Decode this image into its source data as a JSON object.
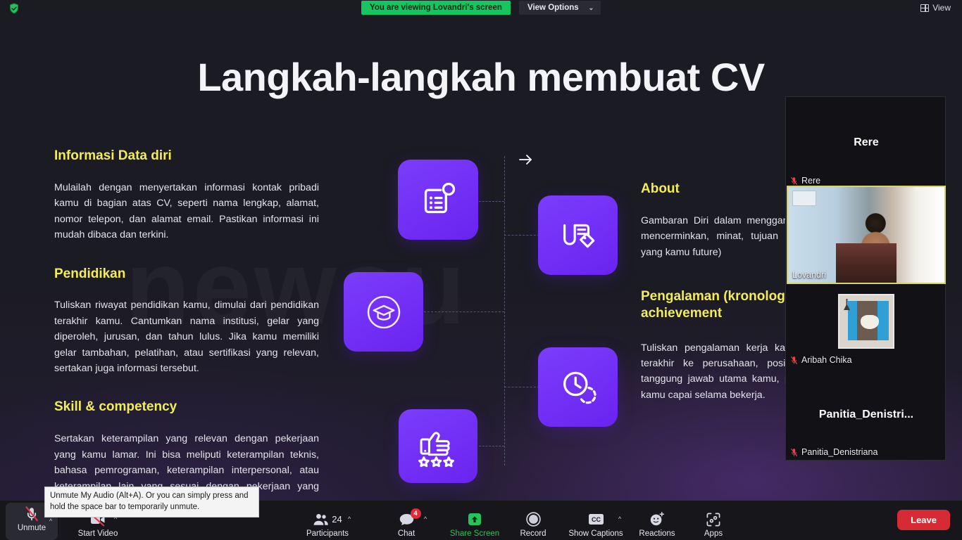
{
  "topbar": {
    "encryption_icon": "shield-check-icon",
    "share_banner": "You are viewing Lovandri's screen",
    "view_options_label": "View Options",
    "view_options_caret": "⌄",
    "view_button_label": "View",
    "view_button_icon": "grid-view-icon"
  },
  "slide": {
    "title": "Langkah-langkah membuat CV",
    "watermark": "newsu",
    "cursor_icon": "arrow-right-cursor",
    "left_sections": [
      {
        "heading": "Informasi Data diri",
        "body": "Mulailah dengan menyertakan informasi kontak pribadi kamu di bagian atas CV, seperti nama lengkap, alamat, nomor telepon, dan alamat email. Pastikan informasi ini mudah dibaca dan terkini."
      },
      {
        "heading": "Pendidikan",
        "body": "Tuliskan riwayat pendidikan kamu, dimulai dari pendidikan terakhir kamu. Cantumkan nama institusi, gelar yang diperoleh, jurusan, dan tahun lulus. Jika kamu memiliki gelar tambahan, pelatihan, atau sertifikasi yang relevan, sertakan juga informasi tersebut."
      },
      {
        "heading": "Skill & competency",
        "body": "Sertakan keterampilan yang relevan dengan pekerjaan yang kamu lamar. Ini bisa meliputi keterampilan teknis, bahasa pemrograman, keterampilan interpersonal, atau keterampilan lain yang sesuai dengan pekerjaan yang kamu lamar."
      }
    ],
    "right_sections": [
      {
        "heading": "About",
        "body": "Gambaran Diri dalam menggambarkan diri kamu, mencerminkan, minat, tujuan keterampilan kunci yang kamu future)"
      },
      {
        "heading": "Pengalaman (kronologi) & achievement",
        "body": "Tuliskan pengalaman kerja kamu dari pekerjaan terakhir ke perusahaan, posisi yang diperoleh tanggung jawab utama kamu, prestasi yang telah kamu capai selama bekerja."
      }
    ],
    "icon_tiles": [
      {
        "name": "clipboard-list-icon"
      },
      {
        "name": "graduation-cap-icon"
      },
      {
        "name": "document-tag-icon"
      },
      {
        "name": "clock-history-icon"
      },
      {
        "name": "thumbs-up-stars-icon"
      }
    ]
  },
  "participants_panel": [
    {
      "display_name": "Rere",
      "label": "Rere",
      "muted": true,
      "has_video": false,
      "avatar": "none"
    },
    {
      "display_name": "Lovandri",
      "label": "Lovandri",
      "muted": false,
      "has_video": true,
      "avatar": "video"
    },
    {
      "display_name": "Aribah Chika",
      "label": "Aribah Chika",
      "muted": true,
      "has_video": false,
      "avatar": "photo"
    },
    {
      "display_name": "Panitia_Denistri...",
      "label": "Panitia_Denistriana",
      "muted": true,
      "has_video": false,
      "avatar": "none"
    }
  ],
  "tooltip": {
    "text": "Unmute My Audio (Alt+A). Or you can simply press and hold the space bar to temporarily unmute."
  },
  "toolbar": {
    "items": [
      {
        "label": "Unmute",
        "icon": "microphone-muted-icon",
        "caret": true,
        "badge": null,
        "count": null,
        "highlight": false,
        "active": true
      },
      {
        "label": "Start Video",
        "icon": "camera-off-icon",
        "caret": true,
        "badge": null,
        "count": null,
        "highlight": false,
        "active": false
      },
      {
        "label": "Participants",
        "icon": "people-icon",
        "caret": true,
        "badge": null,
        "count": "24",
        "highlight": false,
        "active": false
      },
      {
        "label": "Chat",
        "icon": "chat-bubble-icon",
        "caret": true,
        "badge": "4",
        "count": null,
        "highlight": false,
        "active": false
      },
      {
        "label": "Share Screen",
        "icon": "share-screen-icon",
        "caret": false,
        "badge": null,
        "count": null,
        "highlight": true,
        "active": false
      },
      {
        "label": "Record",
        "icon": "record-circle-icon",
        "caret": false,
        "badge": null,
        "count": null,
        "highlight": false,
        "active": false
      },
      {
        "label": "Show Captions",
        "icon": "closed-captions-icon",
        "caret": true,
        "badge": null,
        "count": null,
        "highlight": false,
        "active": false
      },
      {
        "label": "Reactions",
        "icon": "smiley-plus-icon",
        "caret": false,
        "badge": null,
        "count": null,
        "highlight": false,
        "active": false
      },
      {
        "label": "Apps",
        "icon": "apps-icon",
        "caret": false,
        "badge": null,
        "count": null,
        "highlight": false,
        "active": false
      }
    ],
    "leave_label": "Leave"
  },
  "colors": {
    "accent_purple": "#7b3dfb",
    "heading_yellow": "#f2ec5a",
    "share_green": "#16c55f",
    "leave_red": "#d62b35",
    "badge_red": "#e02b3a"
  }
}
